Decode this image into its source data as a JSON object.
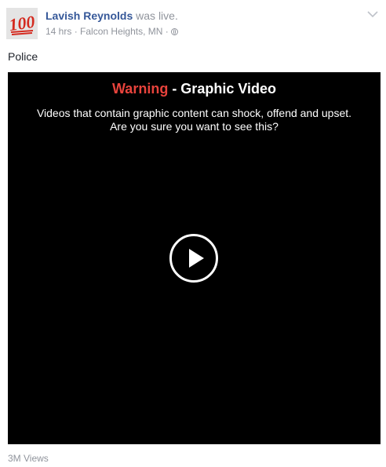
{
  "post": {
    "author": "Lavish Reynolds",
    "action": "was live.",
    "timestamp": "14 hrs",
    "separator": "·",
    "location": "Falcon Heights, MN",
    "privacy_icon": "globe-icon",
    "menu_icon": "chevron-down-icon",
    "text": "Police"
  },
  "avatar": {
    "icon": "hundred-emoji-avatar"
  },
  "video": {
    "warning_word": "Warning",
    "warning_rest": " - Graphic Video",
    "message_line1": "Videos that contain graphic content can shock, offend and upset.",
    "message_line2": "Are you sure you want to see this?",
    "play_icon": "play-icon"
  },
  "views": "3M Views",
  "colors": {
    "link": "#365899",
    "muted": "#90949c",
    "warning": "#e8433c",
    "video_bg": "#000000",
    "text": "#1d2129"
  }
}
